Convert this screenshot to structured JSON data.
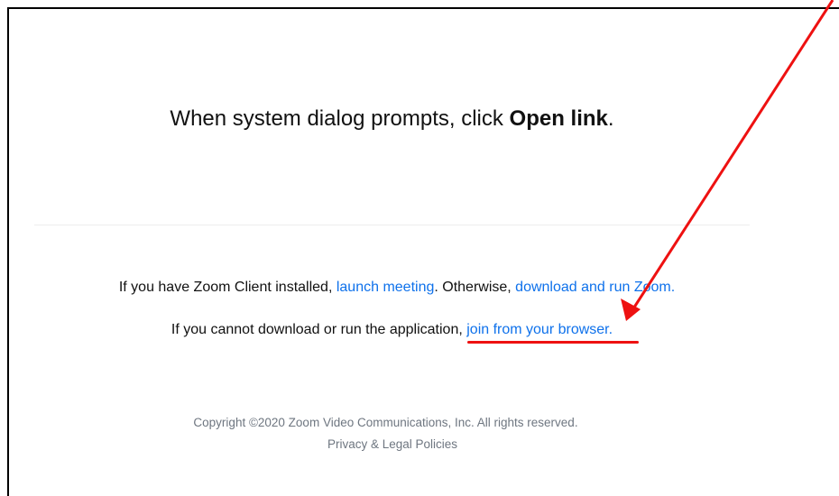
{
  "prompt": {
    "text_before": "When system dialog prompts, click ",
    "bold": "Open link",
    "text_after": "."
  },
  "install_line": {
    "text_before": "If you have Zoom Client installed, ",
    "launch_link": "launch meeting",
    "text_middle": ". Otherwise, ",
    "download_link": "download and run Zoom."
  },
  "browser_line": {
    "text_before": "If you cannot download or run the application, ",
    "browser_link": "join from your browser."
  },
  "footer": {
    "copyright": "Copyright ©2020 Zoom Video Communications, Inc. All rights reserved.",
    "policies_link": "Privacy & Legal Policies"
  },
  "colors": {
    "link": "#0e71eb",
    "annotation": "#ee1111"
  },
  "annotation": {
    "arrow_icon": "arrow-icon",
    "underline": "highlight-underline"
  }
}
